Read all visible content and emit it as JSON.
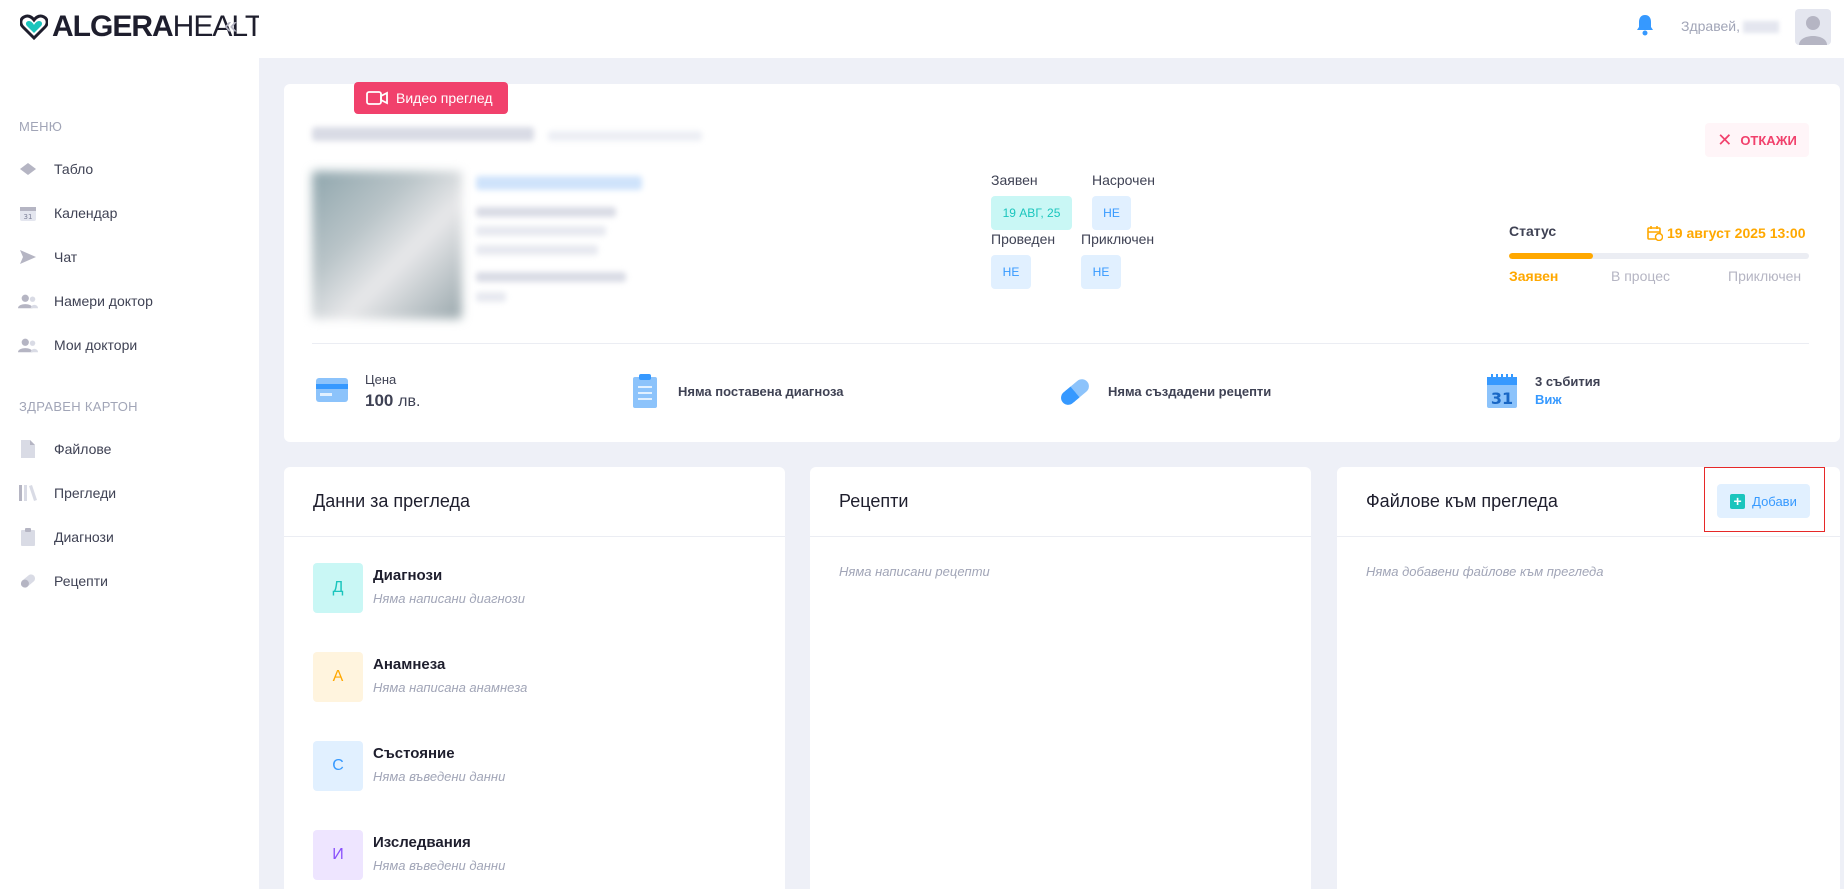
{
  "brand": {
    "name_bold": "ALGERA",
    "name_light": "HEALTH"
  },
  "sidebar": {
    "menu_title": "МЕНЮ",
    "menu_items": [
      {
        "label": "Табло",
        "icon": "layers-icon"
      },
      {
        "label": "Календар",
        "icon": "calendar-icon"
      },
      {
        "label": "Чат",
        "icon": "send-icon"
      },
      {
        "label": "Намери доктор",
        "icon": "users-icon"
      },
      {
        "label": "Мои доктори",
        "icon": "users-icon"
      }
    ],
    "record_title": "ЗДРАВЕН КАРТОН",
    "record_items": [
      {
        "label": "Файлове",
        "icon": "file-icon"
      },
      {
        "label": "Прегледи",
        "icon": "library-icon"
      },
      {
        "label": "Диагнози",
        "icon": "clipboard-icon"
      },
      {
        "label": "Рецепти",
        "icon": "pill-icon"
      }
    ]
  },
  "topbar": {
    "greeting": "Здравей,"
  },
  "exam": {
    "video_badge": "Видео преглед",
    "cancel_label": "ОТКАЖИ",
    "requested_label": "Заявен",
    "requested_value": "19 АВГ, 25",
    "scheduled_label": "Насрочен",
    "scheduled_value": "НЕ",
    "conducted_label": "Проведен",
    "conducted_value": "НЕ",
    "finished_label": "Приключен",
    "finished_value": "НЕ",
    "status_title": "Статус",
    "status_date": "19 август 2025 13:00",
    "progress_fraction": 0.28,
    "steps": [
      "Заявен",
      "В процес",
      "Приключен"
    ],
    "price_label": "Цена",
    "price_value": "100",
    "price_unit": "лв.",
    "diagnosis_note": "Няма поставена диагноза",
    "prescription_note": "Няма създадени рецепти",
    "events_count": "3 събития",
    "events_link": "Виж"
  },
  "cards": {
    "data": {
      "title": "Данни за прегледа",
      "items": [
        {
          "letter": "Д",
          "title": "Диагнози",
          "subtitle": "Няма написани диагнози"
        },
        {
          "letter": "А",
          "title": "Анамнеза",
          "subtitle": "Няма написана анамнеза"
        },
        {
          "letter": "С",
          "title": "Състояние",
          "subtitle": "Няма въведени данни"
        },
        {
          "letter": "И",
          "title": "Изследвания",
          "subtitle": "Няма въведени данни"
        }
      ]
    },
    "prescriptions": {
      "title": "Рецепти",
      "empty": "Няма написани рецепти"
    },
    "files": {
      "title": "Файлове към прегледа",
      "empty": "Няма добавени файлове към прегледа",
      "add_label": "Добави"
    }
  },
  "colors": {
    "accent_blue": "#3699ff",
    "warning": "#ffa800",
    "danger": "#f1416c",
    "teal": "#1bc5bd"
  }
}
